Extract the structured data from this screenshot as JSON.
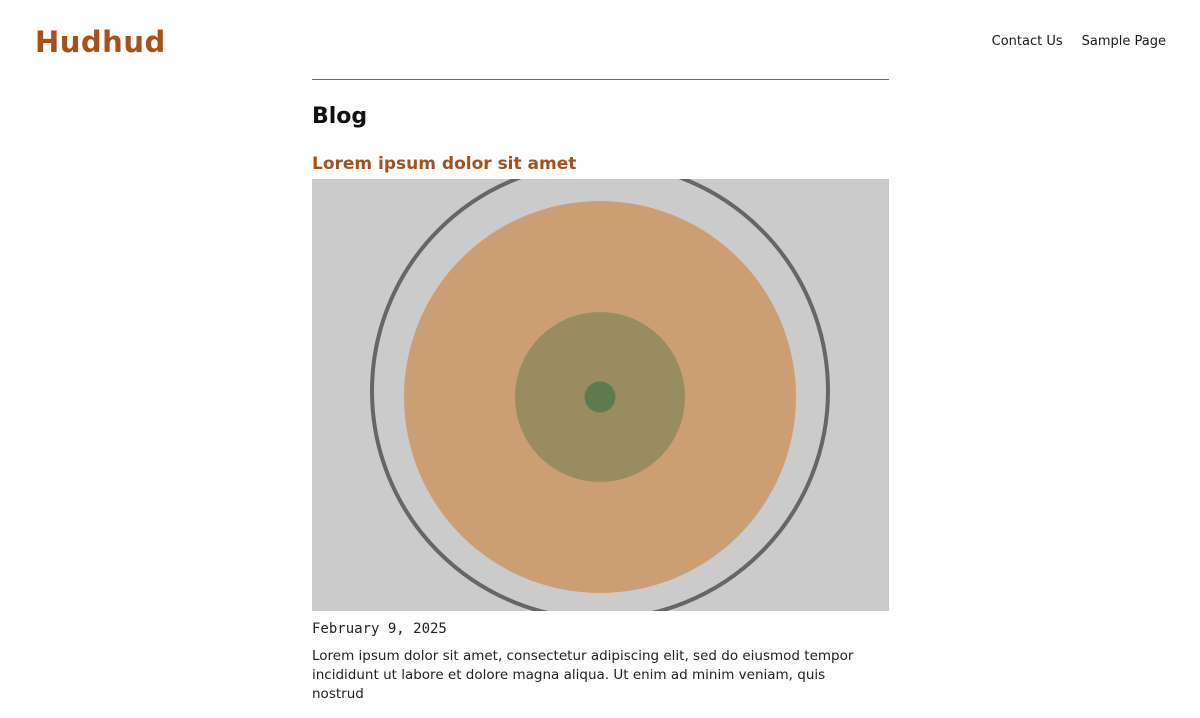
{
  "header": {
    "site_title": "Hudhud",
    "nav": {
      "contact": "Contact Us",
      "sample": "Sample Page"
    }
  },
  "main": {
    "heading": "Blog",
    "post": {
      "title": "Lorem ipsum dolor sit amet",
      "date": "February 9, 2025",
      "excerpt": "Lorem ipsum dolor sit amet, consectetur adipiscing elit, sed do eiusmod tempor incididunt ut labore et dolore magna aliqua. Ut enim ad minim veniam, quis nostrud"
    }
  },
  "colors": {
    "accent": "#a6501c",
    "image_background": "#cbcbcb",
    "ring": "#666666",
    "disc_outer": "#cc9e74",
    "disc_middle": "#9a8c61",
    "disc_center": "#5d7b4c"
  }
}
